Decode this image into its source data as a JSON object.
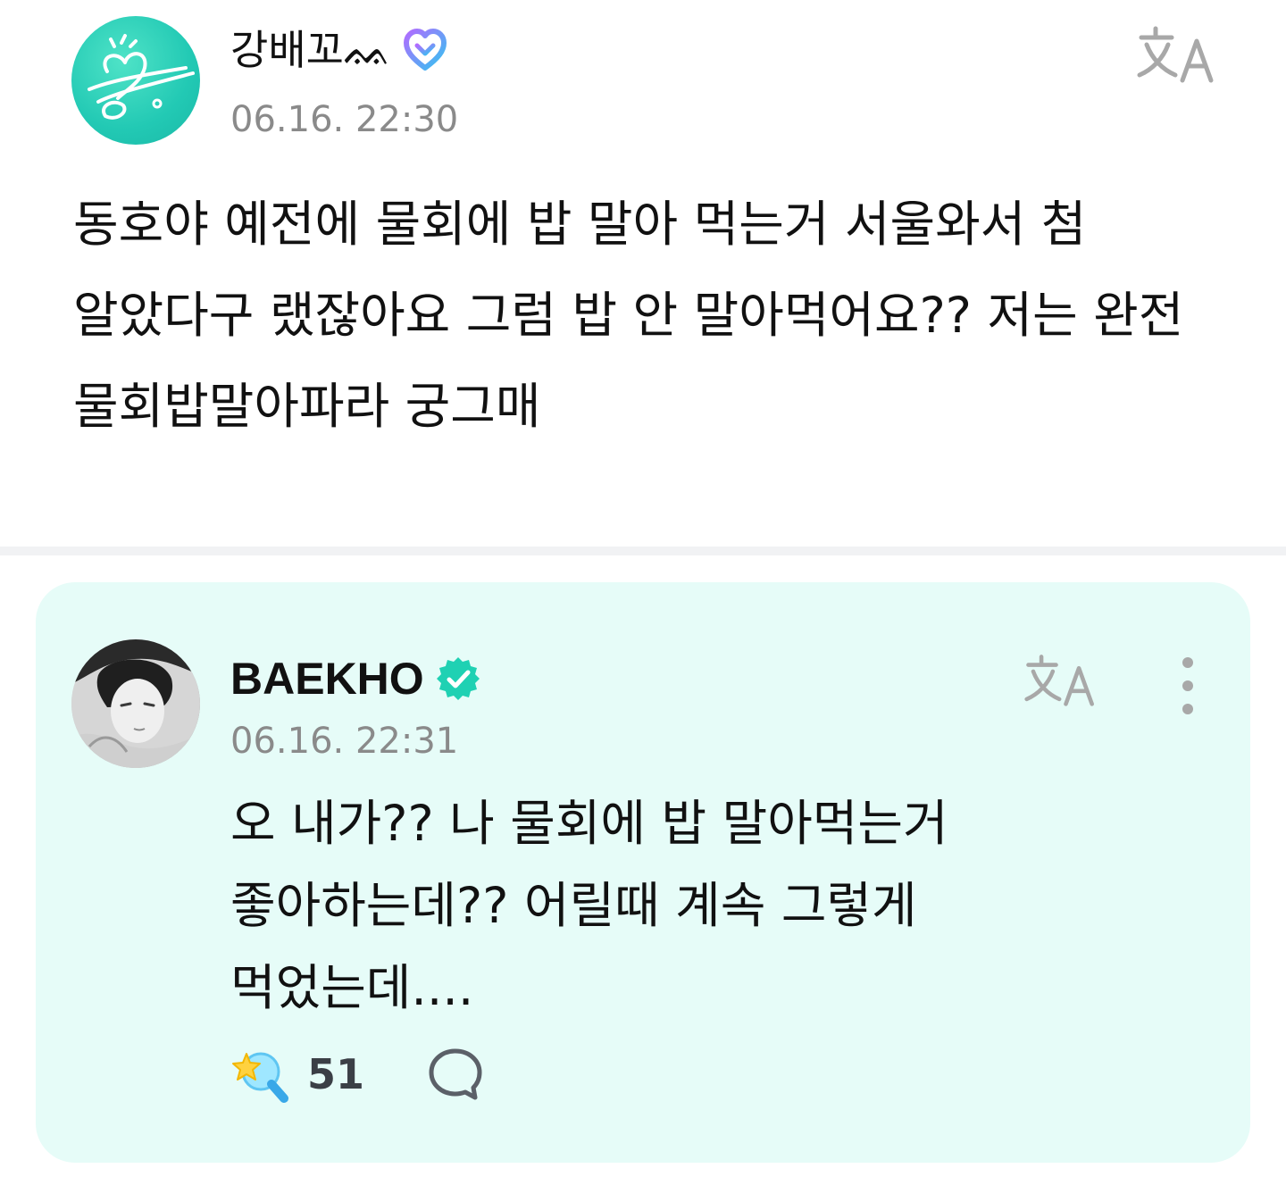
{
  "post": {
    "author": "강배꼬ᨐ",
    "timestamp": "06.16. 22:30",
    "body": "동호야 예전에 물회에 밥 말아 먹는거 서울와서 첨 알았다구 랬잖아요 그럼 밥 안 말아먹어요?? 저는 완전 물회밥말아파라 궁그매",
    "icons": {
      "avatar": "fan-avatar-heart-drawing",
      "badge": "weverse-membership-badge-icon",
      "translate": "translate-icon"
    }
  },
  "reply": {
    "author": "BAEKHO",
    "timestamp": "06.16. 22:31",
    "body": "오 내가?? 나 물회에 밥 말아먹는거 좋아하는데?? 어릴때 계속 그렇게 먹었는데....",
    "like_count": "51",
    "background": "#e6fcf8",
    "icons": {
      "verified": "verified-badge-icon",
      "translate": "translate-icon",
      "more": "more-vertical-icon",
      "like": "star-magic-wand-icon",
      "comment": "comment-bubble-icon"
    }
  },
  "colors": {
    "accent_teal": "#1ecfb2",
    "verified": "#1fd1b3",
    "timestamp_gray": "#8a8a8a",
    "icon_gray": "#a8a8a8"
  }
}
